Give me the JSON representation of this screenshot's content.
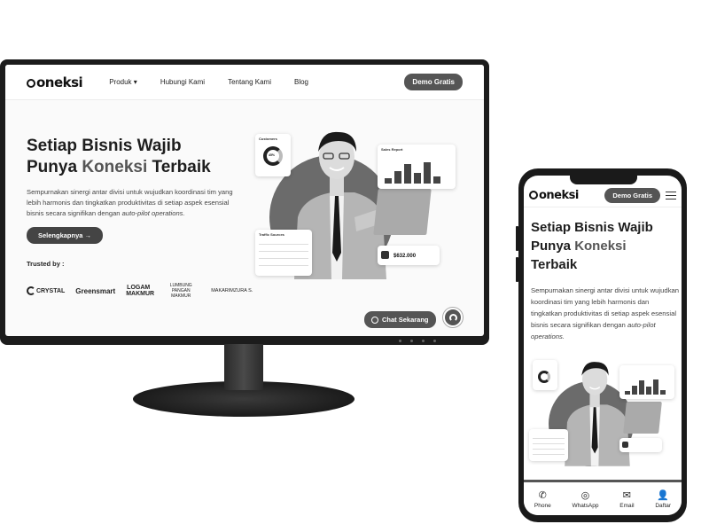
{
  "brand": {
    "logo_text": "oneksi"
  },
  "desktop": {
    "nav": {
      "items": [
        {
          "label": "Produk",
          "has_dropdown": true
        },
        {
          "label": "Hubungi Kami"
        },
        {
          "label": "Tentang Kami"
        },
        {
          "label": "Blog"
        }
      ],
      "demo_label": "Demo Gratis"
    },
    "hero": {
      "title_line1": "Setiap Bisnis Wajib",
      "title_pre": "Punya ",
      "title_brand": "Koneksi",
      "title_post": " Terbaik",
      "desc_text": "Sempurnakan sinergi antar divisi untuk wujudkan koordinasi tim yang lebih harmonis dan tingkatkan produktivitas di setiap aspek esensial bisnis secara signifikan dengan ",
      "desc_em": "auto-pilot operations.",
      "cta_label": "Selengkapnya →"
    },
    "trusted_label": "Trusted by :",
    "trusted_logos": [
      "CRYSTAL",
      "Greensmart",
      "LOGAM MAKMUR",
      "LUMBUNG PANGAN MAKMUR",
      "MAKARIMZURA S."
    ],
    "chat_label": "Chat Sekarang",
    "cards": {
      "customers": "Customers",
      "customers_pct": "45%",
      "sales_report": "Sales Report",
      "traffic": "Traffic Sources",
      "amount": "$632.000"
    }
  },
  "mobile": {
    "demo_label": "Demo Gratis",
    "title_line1": "Setiap Bisnis Wajib",
    "title_pre": "Punya ",
    "title_brand": "Koneksi",
    "title_line3": "Terbaik",
    "desc_text": "Sempurnakan sinergi antar divisi untuk wujudkan koordinasi tim yang lebih harmonis dan tingkatkan produktivitas di setiap aspek esensial bisnis secara signifikan dengan ",
    "desc_em": "auto-pilot operations.",
    "bottom_tabs": [
      {
        "label": "Phone",
        "icon": "phone-icon"
      },
      {
        "label": "WhatsApp",
        "icon": "whatsapp-icon"
      },
      {
        "label": "Email",
        "icon": "email-icon"
      },
      {
        "label": "Daftar",
        "icon": "add-user-icon"
      }
    ]
  },
  "colors": {
    "button": "#555555",
    "text": "#1e1e1e",
    "brand_word": "#555555"
  }
}
